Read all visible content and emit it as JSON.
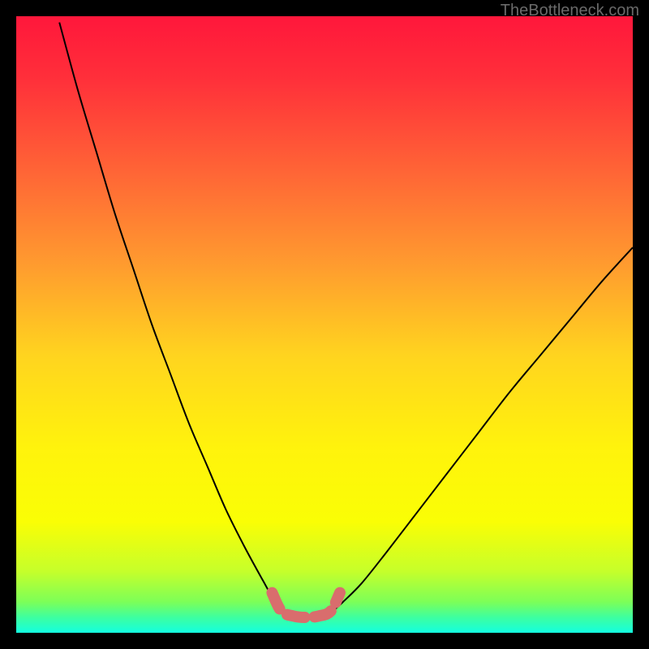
{
  "watermark": "TheBottleneck.com",
  "chart_data": {
    "type": "line",
    "title": "",
    "xlabel": "",
    "ylabel": "",
    "xlim": [
      0,
      100
    ],
    "ylim": [
      0,
      100
    ],
    "series": [
      {
        "name": "curve-left",
        "x": [
          7,
          10,
          13,
          16,
          19,
          22,
          25,
          28,
          31,
          34,
          37,
          40,
          42,
          43.5
        ],
        "y": [
          99,
          88,
          78,
          68,
          59,
          50,
          42,
          34,
          27,
          20,
          14,
          8.5,
          5,
          3.2
        ]
      },
      {
        "name": "curve-right",
        "x": [
          51,
          53,
          56,
          60,
          65,
          70,
          75,
          80,
          85,
          90,
          95,
          100
        ],
        "y": [
          3.2,
          5,
          8,
          13,
          19.5,
          26,
          32.5,
          39,
          45,
          51,
          57,
          62.5
        ]
      },
      {
        "name": "optimal-zone-marker",
        "x": [
          41.5,
          43,
          45,
          47,
          49,
          51,
          52.5
        ],
        "y": [
          6.5,
          3.5,
          2.7,
          2.5,
          2.7,
          3.5,
          6.5
        ]
      }
    ],
    "gradient_stops": [
      {
        "offset": 0.0,
        "color": "#ff173b"
      },
      {
        "offset": 0.1,
        "color": "#ff2f3a"
      },
      {
        "offset": 0.25,
        "color": "#ff6436"
      },
      {
        "offset": 0.4,
        "color": "#ff9a2f"
      },
      {
        "offset": 0.55,
        "color": "#ffd41f"
      },
      {
        "offset": 0.7,
        "color": "#fff30c"
      },
      {
        "offset": 0.82,
        "color": "#fafe05"
      },
      {
        "offset": 0.9,
        "color": "#c6ff2a"
      },
      {
        "offset": 0.95,
        "color": "#7cff58"
      },
      {
        "offset": 0.975,
        "color": "#3dffa0"
      },
      {
        "offset": 1.0,
        "color": "#13ffe0"
      }
    ],
    "colors": {
      "curve": "#000000",
      "marker": "#d96d6d",
      "background_frame": "#000000"
    }
  }
}
